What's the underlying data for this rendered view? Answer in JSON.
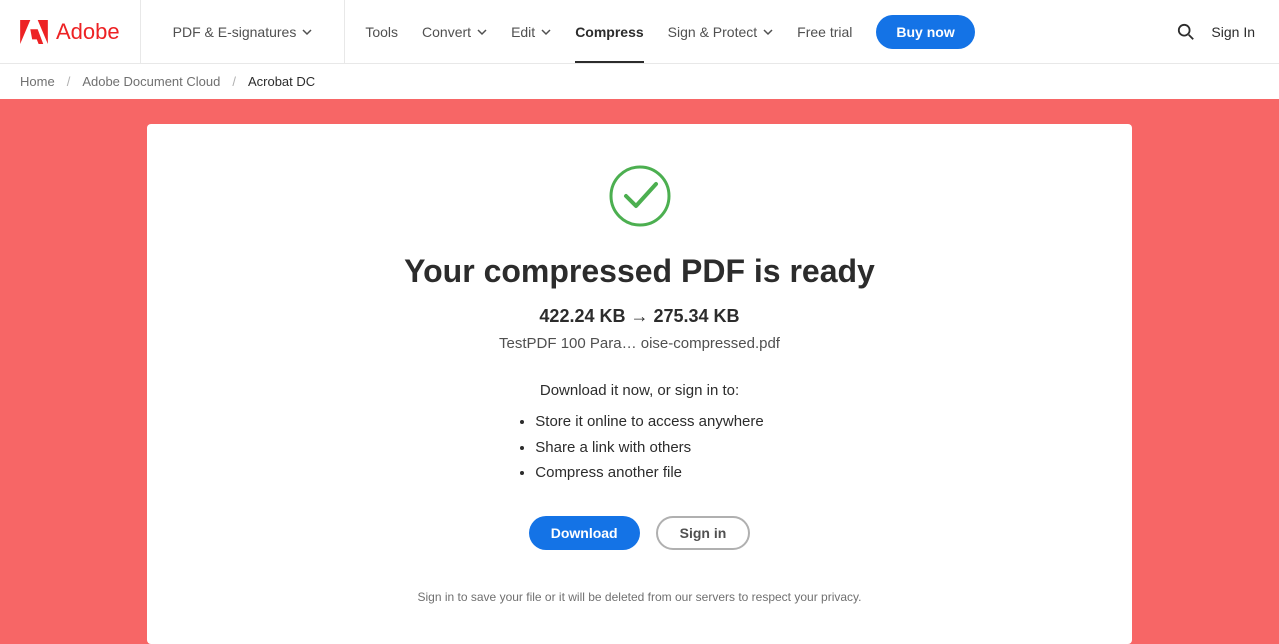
{
  "header": {
    "brand": "Adobe",
    "pdf_esign": "PDF & E-signatures",
    "tools": "Tools",
    "convert": "Convert",
    "edit": "Edit",
    "compress": "Compress",
    "sign_protect": "Sign & Protect",
    "free_trial": "Free trial",
    "buy_now": "Buy now",
    "sign_in": "Sign In"
  },
  "breadcrumb": {
    "home": "Home",
    "doc_cloud": "Adobe Document Cloud",
    "acrobat": "Acrobat DC"
  },
  "card": {
    "title": "Your compressed PDF is ready",
    "size_before": "422.24 KB",
    "size_arrow": " → ",
    "size_after": "275.34 KB",
    "filename": "TestPDF 100 Para…    oise-compressed.pdf",
    "instruction": "Download it now, or sign in to:",
    "feature1": "Store it online to access anywhere",
    "feature2": "Share a link with others",
    "feature3": "Compress another file",
    "download_btn": "Download",
    "signin_btn": "Sign in",
    "privacy": "Sign in to save your file or it will be deleted from our servers to respect your privacy."
  }
}
